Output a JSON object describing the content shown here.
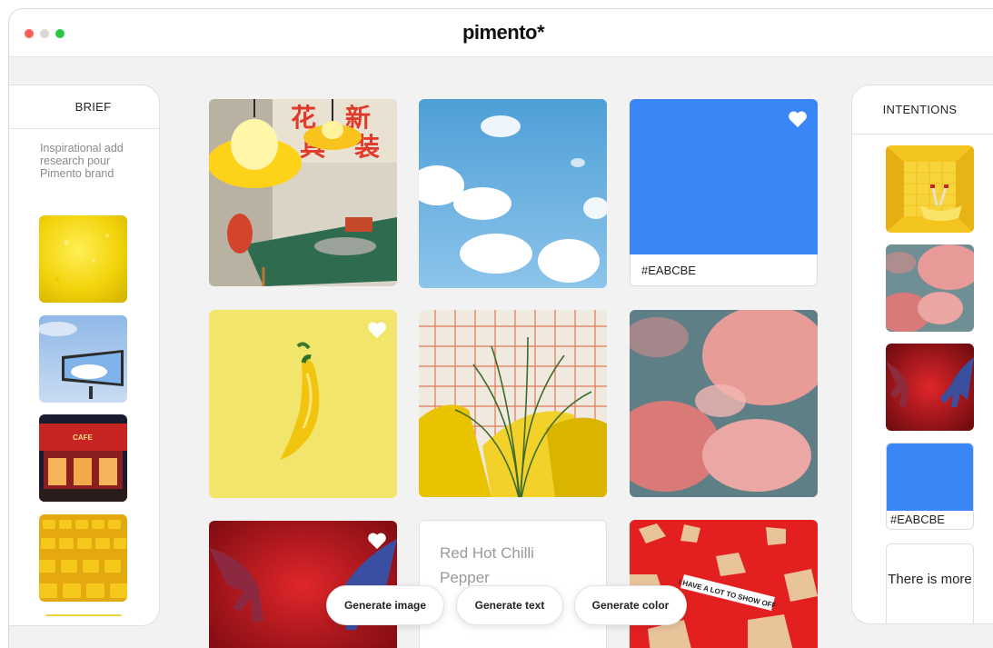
{
  "window": {
    "title": "pimento*"
  },
  "brief": {
    "header": "BRIEF",
    "text": "Inspirational add research pour Pimento brand",
    "thumbnails": [
      "lemon-texture",
      "sky-billboard",
      "red-cafe-facade",
      "yellow-stadium-seats",
      "yellow-strip"
    ]
  },
  "intentions": {
    "header": "INTENTIONS",
    "thumbnails": [
      "yellow-room-bathtub",
      "pink-clouds",
      "red-hands"
    ],
    "swatch": {
      "hex": "#EABCBE",
      "color": "#3b86f7"
    },
    "more_text": "There is more"
  },
  "grid": {
    "swatch": {
      "hex": "#EABCBE",
      "color": "#3b86f7"
    },
    "text_card": "Red Hot Chilli Pepper",
    "items": [
      "cafe-lamps",
      "blue-sky-clouds",
      "blue-swatch",
      "yellow-chilli",
      "yellow-chairs-plant",
      "pink-clouds",
      "red-hands",
      "text-card",
      "fortune-cookies"
    ],
    "fortune_text": "I HAVE A LOT TO SHOW OFF"
  },
  "actions": {
    "generate_image": "Generate image",
    "generate_text": "Generate text",
    "generate_color": "Generate color"
  },
  "colors": {
    "accent_blue": "#3b86f7",
    "yellow": "#f3d23a",
    "red": "#d8252c"
  }
}
